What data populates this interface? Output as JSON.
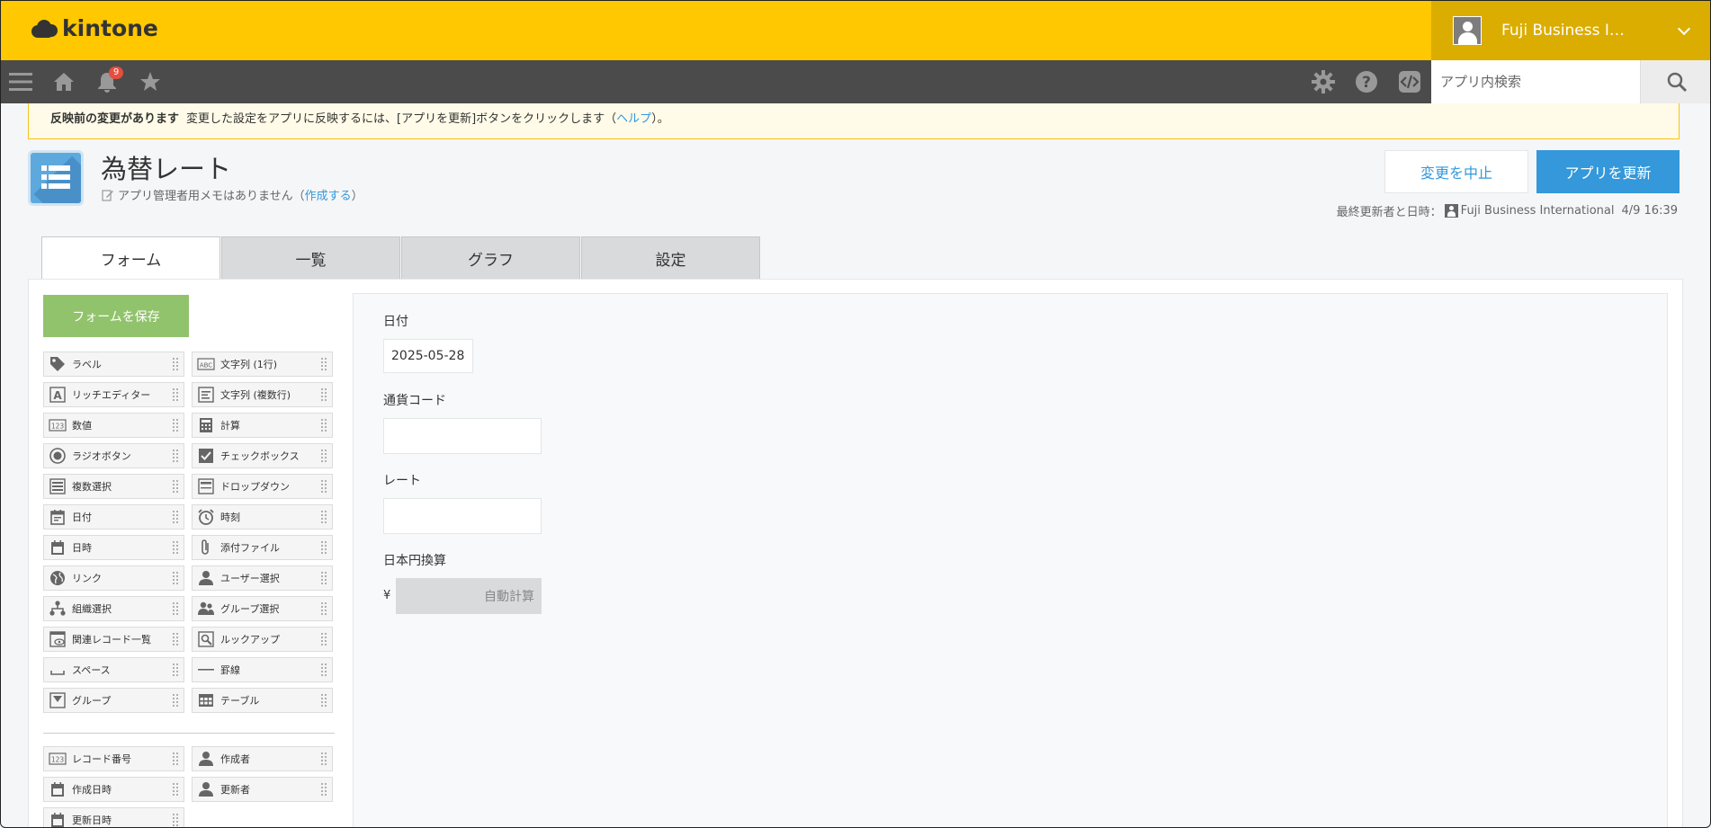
{
  "header": {
    "logo_text": "kintone",
    "user_name": "Fuji Business I…",
    "brand_color": "#ffc800"
  },
  "nav": {
    "notification_count": "9",
    "search_placeholder": "アプリ内検索",
    "icons": [
      "menu-icon",
      "home-icon",
      "bell-icon",
      "star-icon",
      "gear-icon",
      "help-icon",
      "code-icon",
      "search-icon"
    ]
  },
  "notice": {
    "title": "反映前の変更があります",
    "text_before": "変更した設定をアプリに反映するには、[アプリを更新]ボタンをクリックします（",
    "link": "ヘルプ",
    "text_after": "）。"
  },
  "app": {
    "title": "為替レート",
    "memo_text": "アプリ管理者用メモはありません（",
    "memo_link": "作成する",
    "memo_close": "）",
    "cancel_label": "変更を中止",
    "update_label": "アプリを更新",
    "last_updated_label": "最終更新者と日時：",
    "last_updated_user": "Fuji Business International",
    "last_updated_time": "4/9 16:39"
  },
  "tabs": [
    {
      "label": "フォーム",
      "active": true
    },
    {
      "label": "一覧",
      "active": false
    },
    {
      "label": "グラフ",
      "active": false
    },
    {
      "label": "設定",
      "active": false
    }
  ],
  "form": {
    "save_label": "フォームを保存",
    "palette": [
      {
        "label": "ラベル",
        "icon": "tag-icon"
      },
      {
        "label": "文字列 (1行)",
        "icon": "abc-icon"
      },
      {
        "label": "リッチエディター",
        "icon": "rich-text-icon"
      },
      {
        "label": "文字列 (複数行)",
        "icon": "multiline-icon"
      },
      {
        "label": "数値",
        "icon": "number-icon"
      },
      {
        "label": "計算",
        "icon": "calculator-icon"
      },
      {
        "label": "ラジオボタン",
        "icon": "radio-icon"
      },
      {
        "label": "チェックボックス",
        "icon": "checkbox-icon"
      },
      {
        "label": "複数選択",
        "icon": "multi-select-icon"
      },
      {
        "label": "ドロップダウン",
        "icon": "dropdown-icon"
      },
      {
        "label": "日付",
        "icon": "date-icon"
      },
      {
        "label": "時刻",
        "icon": "clock-icon"
      },
      {
        "label": "日時",
        "icon": "datetime-icon"
      },
      {
        "label": "添付ファイル",
        "icon": "attachment-icon"
      },
      {
        "label": "リンク",
        "icon": "globe-icon"
      },
      {
        "label": "ユーザー選択",
        "icon": "user-icon"
      },
      {
        "label": "組織選択",
        "icon": "org-icon"
      },
      {
        "label": "グループ選択",
        "icon": "group-icon"
      },
      {
        "label": "関連レコード一覧",
        "icon": "related-records-icon"
      },
      {
        "label": "ルックアップ",
        "icon": "lookup-icon"
      },
      {
        "label": "スペース",
        "icon": "space-icon"
      },
      {
        "label": "罫線",
        "icon": "line-icon"
      },
      {
        "label": "グループ",
        "icon": "group-field-icon"
      },
      {
        "label": "テーブル",
        "icon": "table-icon"
      }
    ],
    "system_fields": [
      {
        "label": "レコード番号",
        "icon": "number-icon"
      },
      {
        "label": "作成者",
        "icon": "user-icon"
      },
      {
        "label": "作成日時",
        "icon": "datetime-icon"
      },
      {
        "label": "更新者",
        "icon": "user-icon"
      },
      {
        "label": "更新日時",
        "icon": "datetime-icon"
      }
    ],
    "fields": {
      "date_label": "日付",
      "date_value": "2025-05-28",
      "currency_label": "通貨コード",
      "currency_value": "",
      "rate_label": "レート",
      "rate_value": "",
      "jpy_label": "日本円換算",
      "jpy_prefix": "¥",
      "jpy_value": "自動計算"
    }
  }
}
